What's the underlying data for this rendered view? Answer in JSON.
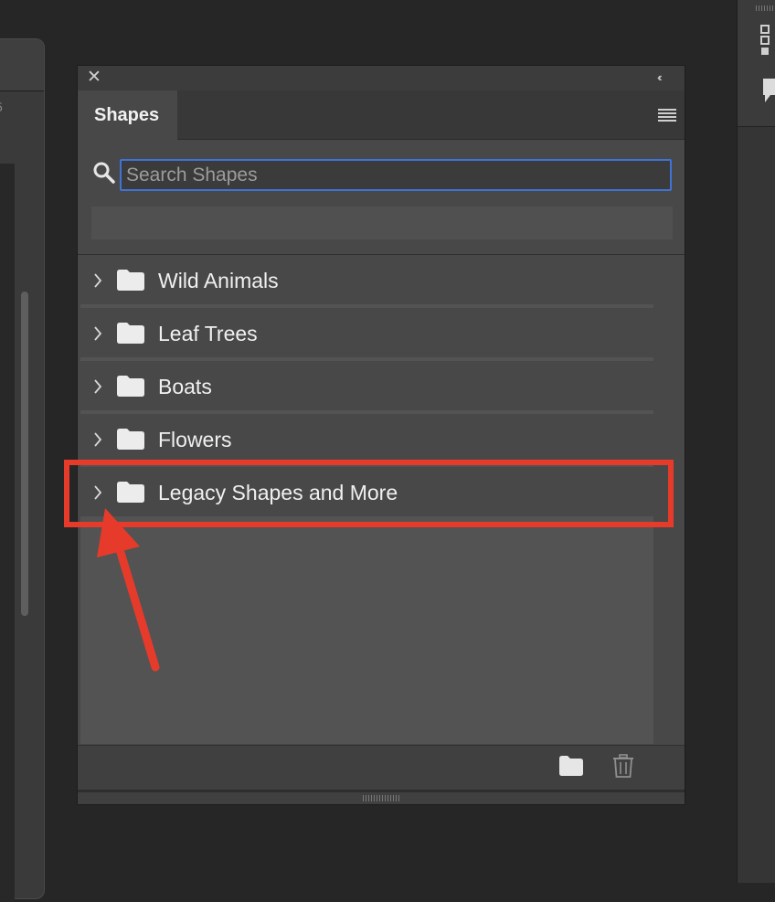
{
  "panel": {
    "tab_label": "Shapes",
    "close_glyph": "✕",
    "collapse_glyph": "‹‹"
  },
  "search": {
    "placeholder": "Search Shapes",
    "value": ""
  },
  "groups": [
    {
      "label": "Wild Animals"
    },
    {
      "label": "Leaf Trees"
    },
    {
      "label": "Boats"
    },
    {
      "label": "Flowers"
    },
    {
      "label": "Legacy Shapes and More"
    }
  ],
  "icons": {
    "search": "search-icon",
    "folder": "folder-icon",
    "chevron": "chevron-right-icon",
    "menu": "panel-menu-icon",
    "new_group": "new-folder-icon",
    "delete": "trash-icon"
  },
  "colors": {
    "annotation": "#e63b2a",
    "focus": "#3f73d6"
  },
  "left_panel": {
    "partial_digit": "5"
  }
}
